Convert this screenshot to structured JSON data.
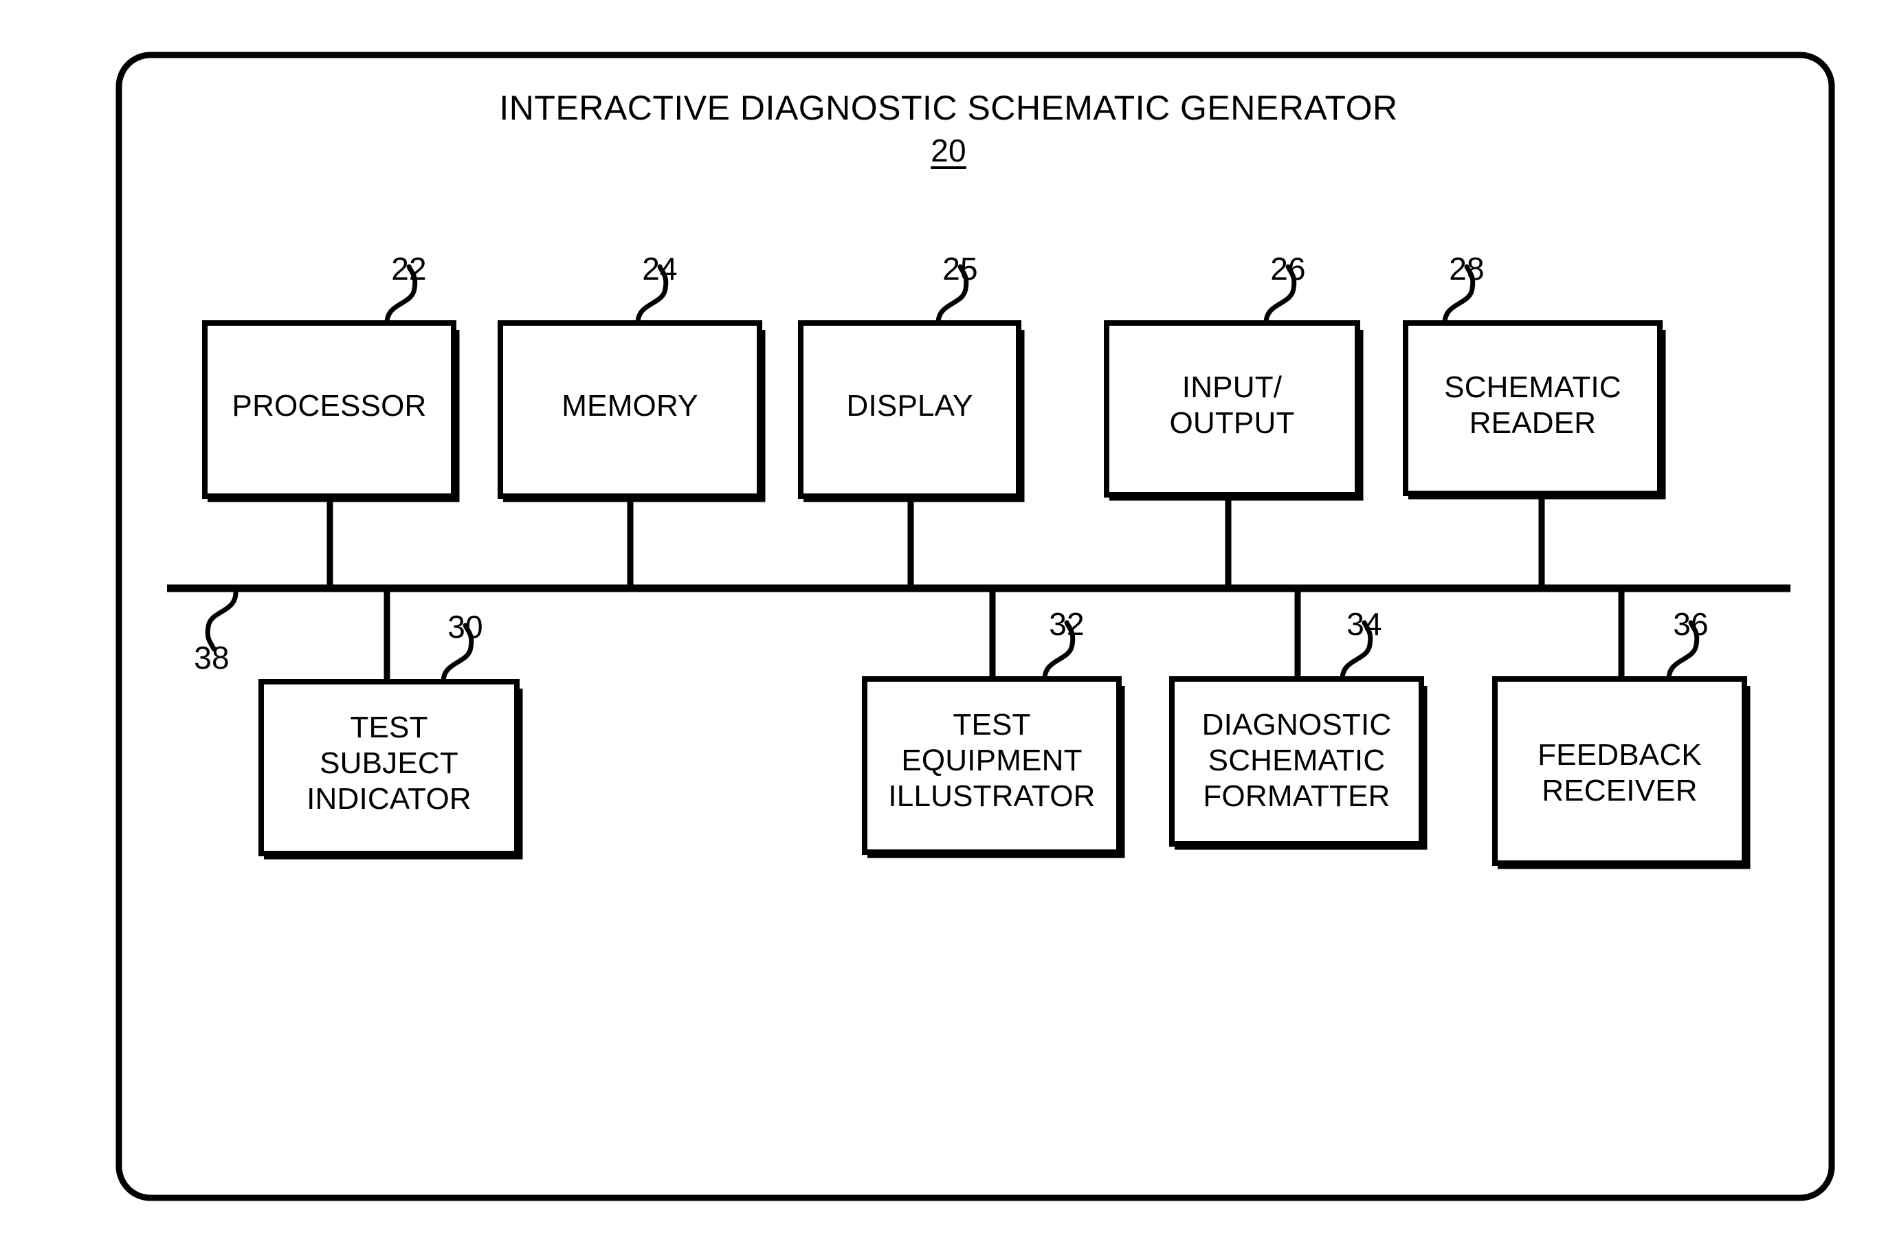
{
  "figure": {
    "title": "INTERACTIVE DIAGNOSTIC SCHEMATIC GENERATOR",
    "title_reference_numeral": "20",
    "bus_reference_numeral": "38",
    "outer_enclosure_name": "interactive-diagnostic-schematic-generator",
    "line_color": "#000000",
    "background_color": "#ffffff"
  },
  "top_row": [
    {
      "label": "PROCESSOR",
      "ref": "22"
    },
    {
      "label": "MEMORY",
      "ref": "24"
    },
    {
      "label": "DISPLAY",
      "ref": "25"
    },
    {
      "label": "INPUT/\nOUTPUT",
      "ref": "26"
    },
    {
      "label": "SCHEMATIC\nREADER",
      "ref": "28"
    }
  ],
  "bottom_row": [
    {
      "label": "TEST\nSUBJECT\nINDICATOR",
      "ref": "30"
    },
    {
      "label": "TEST\nEQUIPMENT\nILLUSTRATOR",
      "ref": "32"
    },
    {
      "label": "DIAGNOSTIC\nSCHEMATIC\nFORMATTER",
      "ref": "34"
    },
    {
      "label": "FEEDBACK\nRECEIVER",
      "ref": "36"
    }
  ]
}
